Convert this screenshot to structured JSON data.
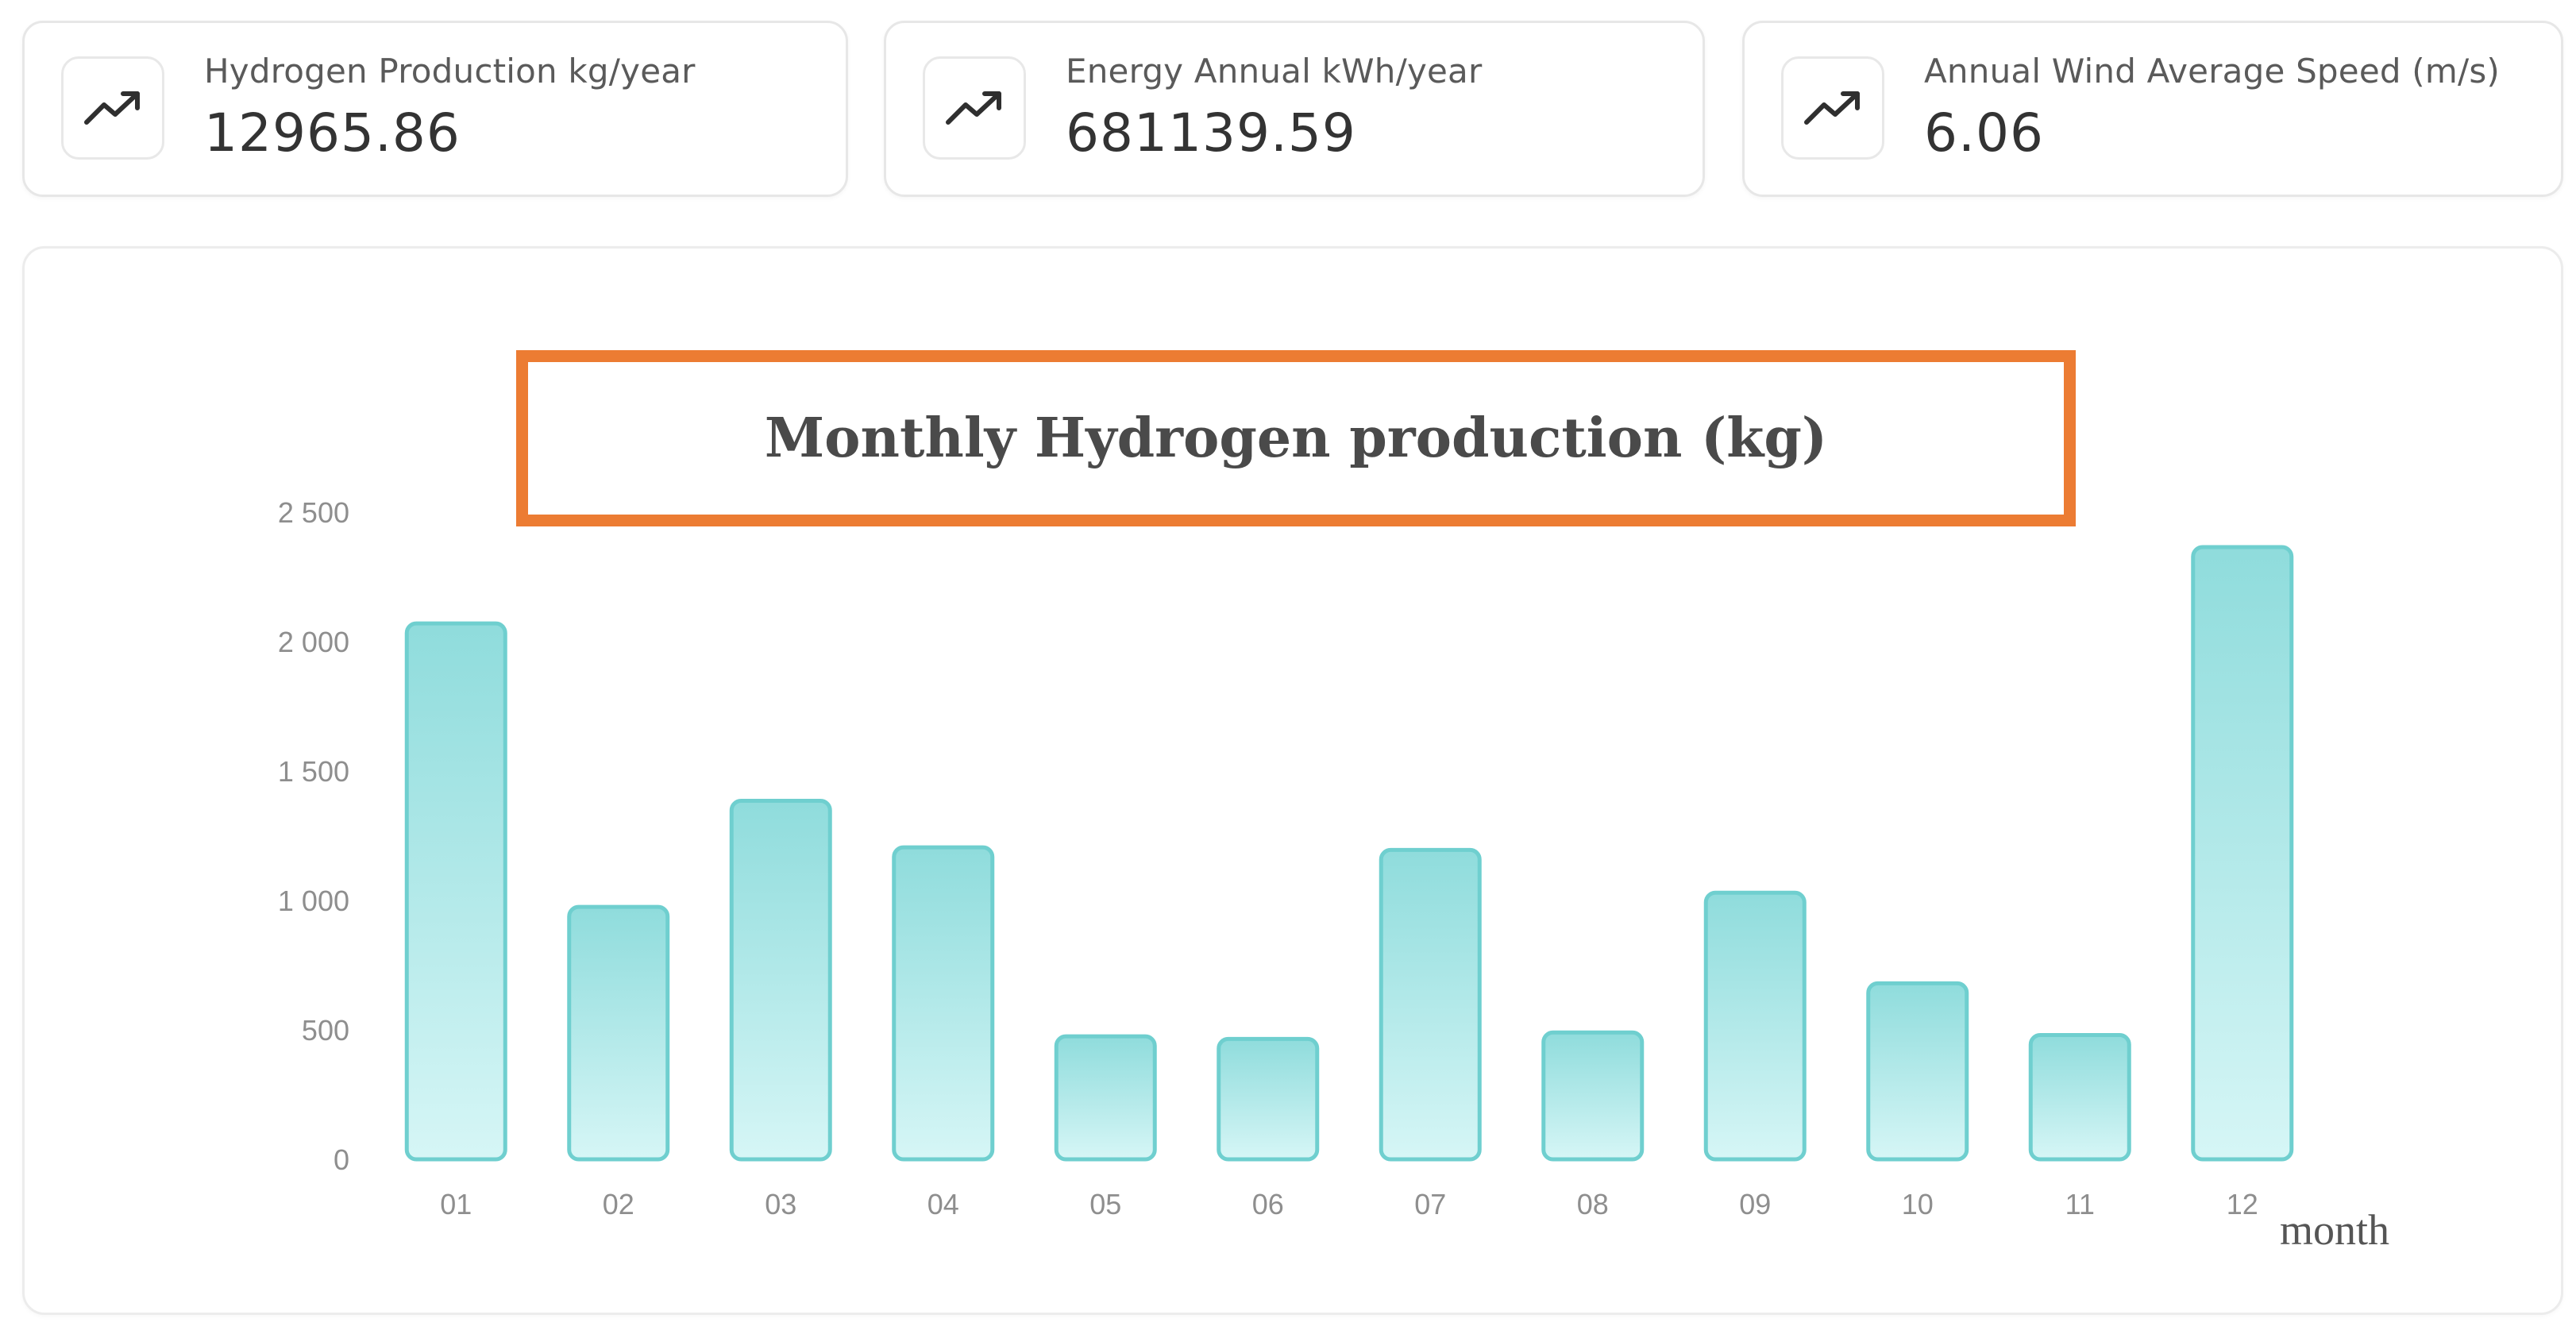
{
  "stat_cards": [
    {
      "label": "Hydrogen Production kg/year",
      "value": "12965.86",
      "icon": "trending-up-icon"
    },
    {
      "label": "Energy Annual kWh/year",
      "value": "681139.59",
      "icon": "trending-up-icon"
    },
    {
      "label": "Annual Wind Average Speed (m/s)",
      "value": "6.06",
      "icon": "trending-up-icon"
    }
  ],
  "colors": {
    "bar_top": "#8fdcdc",
    "bar_bottom": "#d6f6f6",
    "bar_stroke": "#6fcfcf",
    "title_border": "#ec7c33",
    "axis_text": "#8e8e8e"
  },
  "chart_data": {
    "type": "bar",
    "title": "Monthly Hydrogen production (kg)",
    "xlabel": "month",
    "ylabel": "",
    "categories": [
      "01",
      "02",
      "03",
      "04",
      "05",
      "06",
      "07",
      "08",
      "09",
      "10",
      "11",
      "12"
    ],
    "values": [
      2070,
      975,
      1385,
      1205,
      475,
      465,
      1195,
      490,
      1030,
      680,
      480,
      2365
    ],
    "yticks": [
      "0",
      "500",
      "1 000",
      "1 500",
      "2 000",
      "2 500"
    ],
    "ylim": [
      0,
      2500
    ],
    "grid": false,
    "legend": "none"
  }
}
